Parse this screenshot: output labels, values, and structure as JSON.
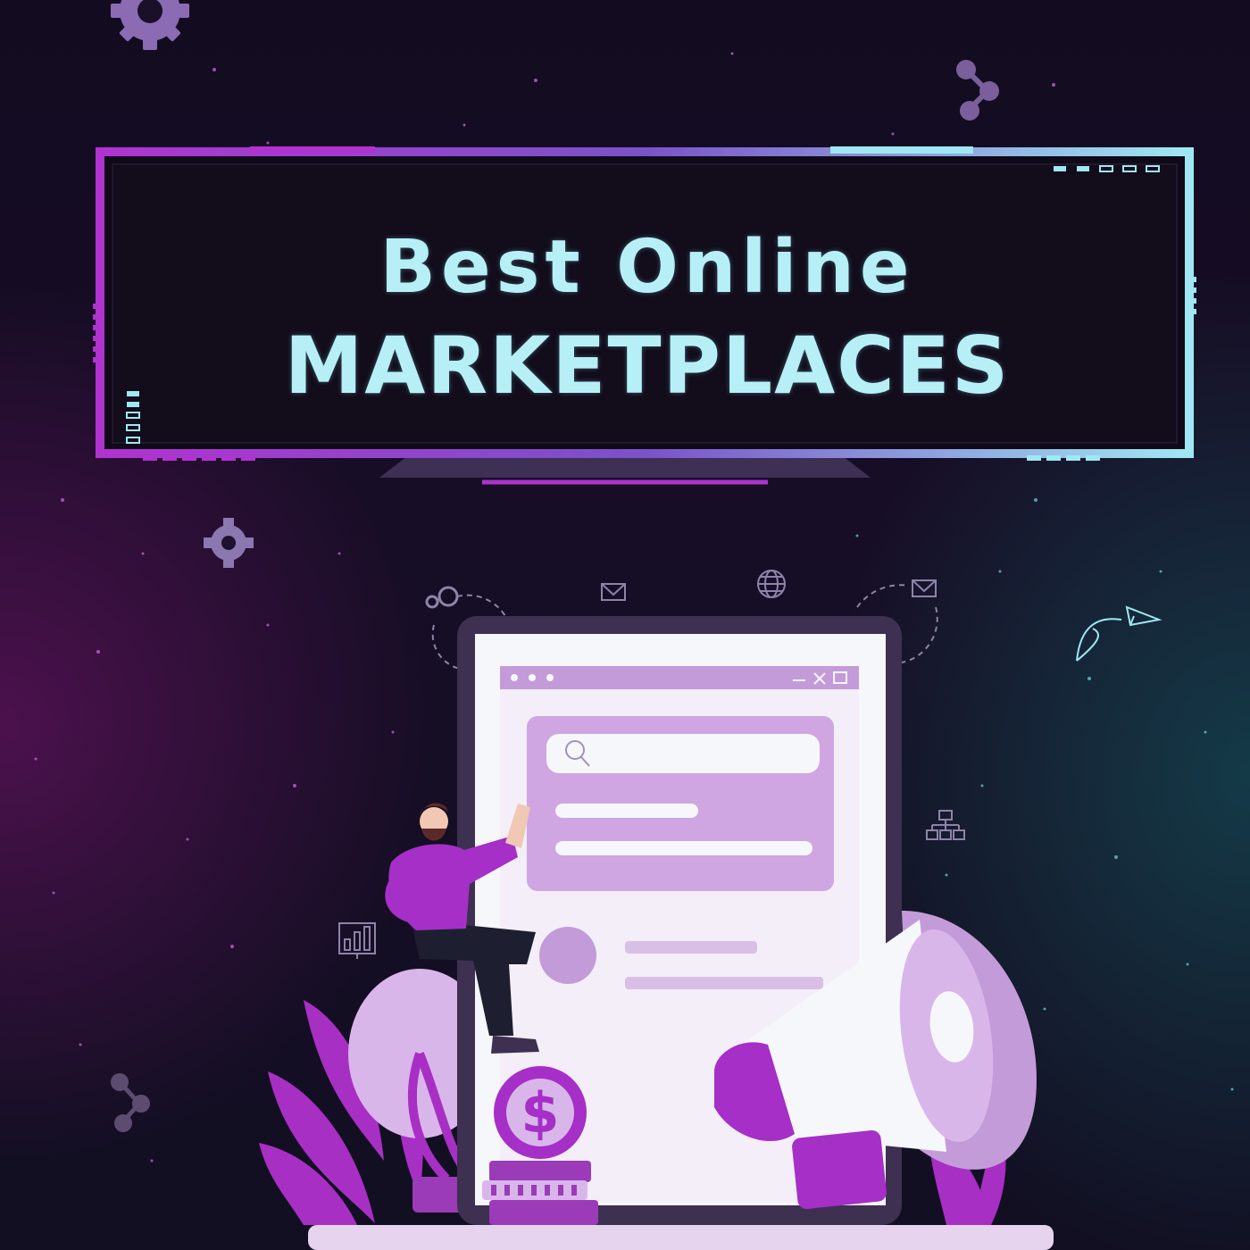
{
  "banner": {
    "line1": "Best Online",
    "line2": "MARKETPLACES"
  },
  "coin": {
    "symbol": "$"
  },
  "colors": {
    "background": "#130c20",
    "accent_purple": "#a52fc7",
    "accent_cyan": "#9fe8f3",
    "title_text": "#b6f0f6",
    "panel_light": "#e6d4ef"
  },
  "icons": [
    "gear-icon",
    "molecule-icon",
    "mail-icon",
    "globe-icon",
    "paper-plane-icon",
    "org-chart-icon",
    "bar-chart-icon",
    "search-icon",
    "lightbulb-icon",
    "megaphone-icon",
    "dollar-coin-icon"
  ]
}
